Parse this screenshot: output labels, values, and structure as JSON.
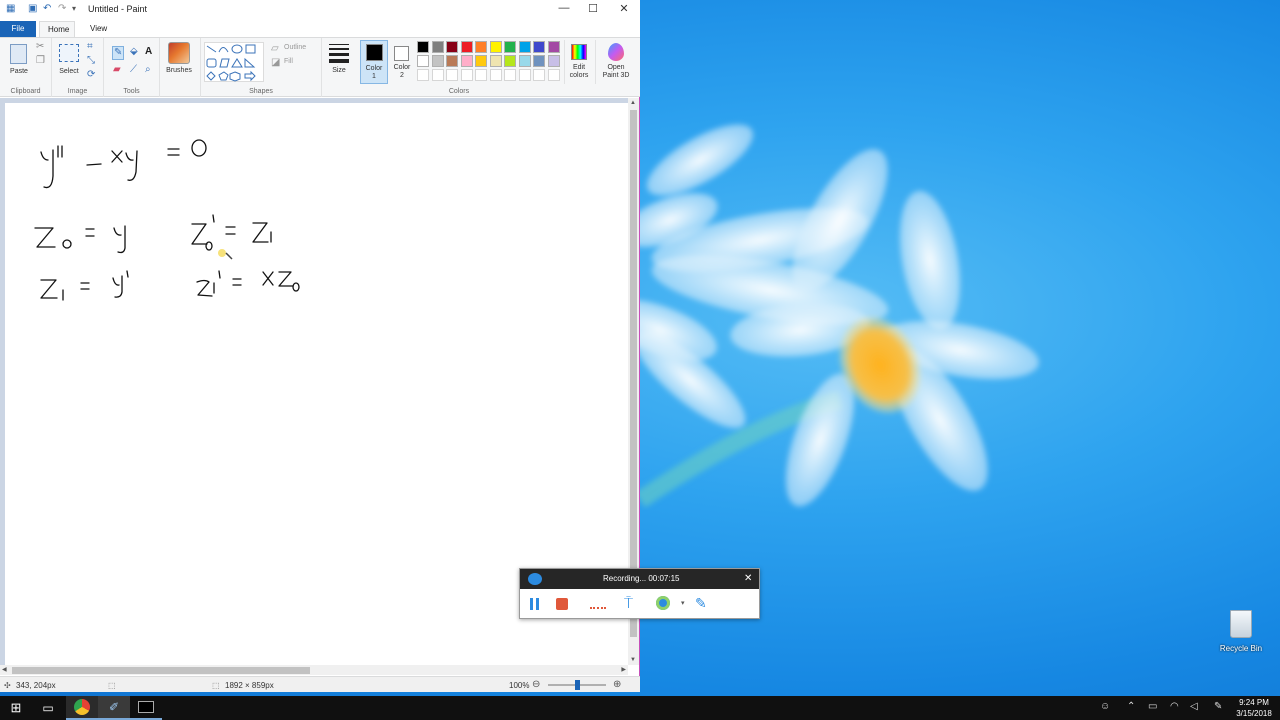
{
  "window": {
    "title": "Untitled - Paint",
    "minimize": "—",
    "maximize": "☐",
    "close": "✕"
  },
  "tabs": {
    "file": "File",
    "home": "Home",
    "view": "View"
  },
  "ribbon": {
    "clipboard": {
      "label": "Clipboard",
      "paste": "Paste"
    },
    "image": {
      "label": "Image",
      "select": "Select"
    },
    "tools": {
      "label": "Tools"
    },
    "brushes": "Brushes",
    "shapes": {
      "label": "Shapes",
      "outline": "Outline",
      "fill": "Fill"
    },
    "size": "Size",
    "color1": {
      "line1": "Color",
      "line2": "1"
    },
    "color2": {
      "line1": "Color",
      "line2": "2"
    },
    "colors": {
      "label": "Colors"
    },
    "edit_colors": {
      "line1": "Edit",
      "line2": "colors"
    },
    "paint3d": {
      "line1": "Open",
      "line2": "Paint 3D"
    }
  },
  "palette": {
    "row1": [
      "#000000",
      "#7f7f7f",
      "#880015",
      "#ed1c24",
      "#ff7f27",
      "#fff200",
      "#22b14c",
      "#00a2e8",
      "#3f48cc",
      "#a349a4"
    ],
    "row2": [
      "#ffffff",
      "#c3c3c3",
      "#b97a57",
      "#ffaec9",
      "#ffc90e",
      "#efe4b0",
      "#b5e61d",
      "#99d9ea",
      "#7092be",
      "#c8bfe7"
    ],
    "active_color1": "#000000",
    "active_color2": "#ffffff"
  },
  "status": {
    "cursor": "343, 204px",
    "size": "1892 × 859px",
    "zoom": "100%",
    "zoom_level": 0.5
  },
  "recorder": {
    "title": "Recording... 00:07:15",
    "close": "✕"
  },
  "desktop": {
    "recycle_bin": "Recycle Bin"
  },
  "taskbar": {
    "time": "9:24 PM",
    "date": "3/15/2018"
  }
}
